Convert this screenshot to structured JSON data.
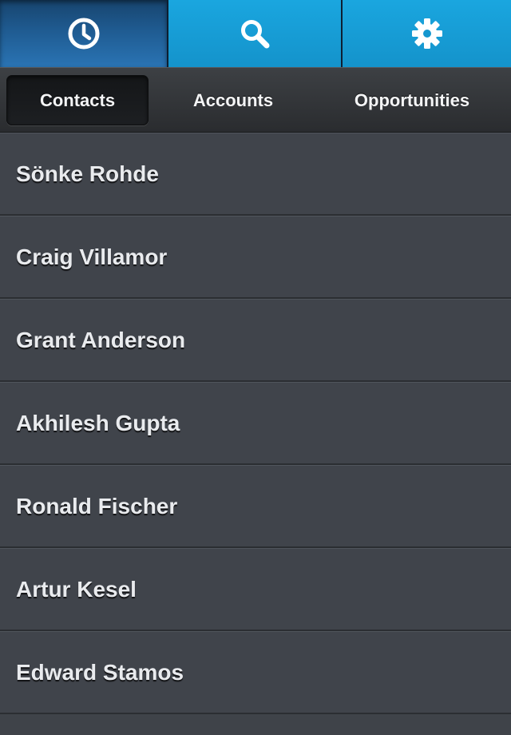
{
  "toolbar": {
    "tools": [
      {
        "icon": "clock-icon",
        "selected": true
      },
      {
        "icon": "search-icon",
        "selected": false
      },
      {
        "icon": "gear-icon",
        "selected": false
      }
    ],
    "colors": {
      "selected": "#1f5b91",
      "default": "#1aa6df"
    }
  },
  "segments": {
    "items": [
      "Contacts",
      "Accounts",
      "Opportunities"
    ],
    "selected": "Contacts"
  },
  "contacts": [
    "Sönke Rohde",
    "Craig Villamor",
    "Grant Anderson",
    "Akhilesh Gupta",
    "Ronald Fischer",
    "Artur Kesel",
    "Edward Stamos"
  ]
}
